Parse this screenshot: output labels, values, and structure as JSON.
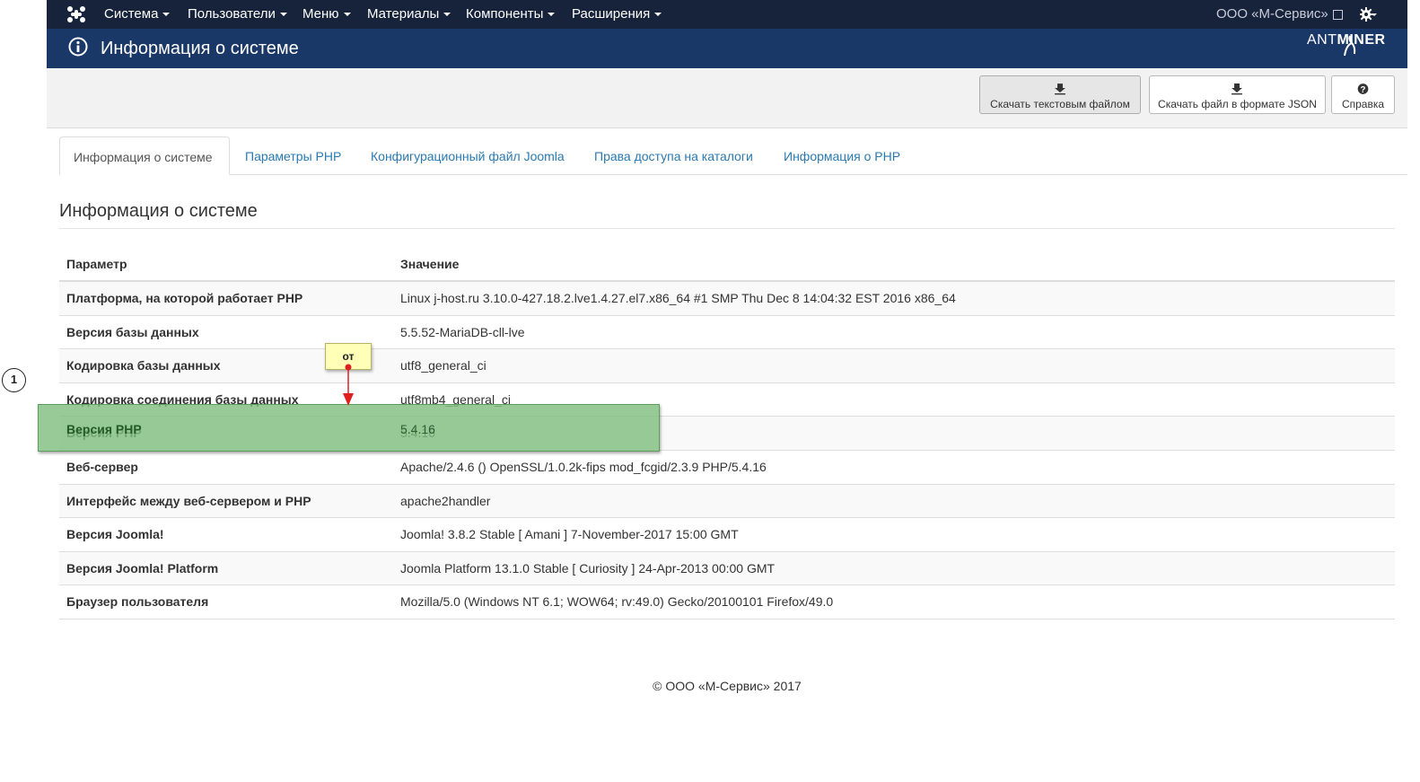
{
  "navbar": {
    "menu": [
      {
        "label": "Система"
      },
      {
        "label": "Пользователи"
      },
      {
        "label": "Меню"
      },
      {
        "label": "Материалы"
      },
      {
        "label": "Компоненты"
      },
      {
        "label": "Расширения"
      }
    ],
    "site_link": "ООО «М-Сервис»"
  },
  "header": {
    "title": "Информация о системе",
    "brand_left": "ANT",
    "brand_right": "MINER"
  },
  "toolbar": {
    "download_text": "Скачать текстовым файлом",
    "download_json": "Скачать файл в формате JSON",
    "help": "Справка"
  },
  "tabs": [
    {
      "label": "Информация о системе"
    },
    {
      "label": "Параметры PHP"
    },
    {
      "label": "Конфигурационный файл Joomla"
    },
    {
      "label": "Права доступа на каталоги"
    },
    {
      "label": "Информация о PHP"
    }
  ],
  "section_title": "Информация о системе",
  "table": {
    "headers": [
      "Параметр",
      "Значение"
    ],
    "rows": [
      {
        "param": "Платформа, на которой работает PHP",
        "value": "Linux j-host.ru 3.10.0-427.18.2.lve1.4.27.el7.x86_64 #1 SMP Thu Dec 8 14:04:32 EST 2016 x86_64"
      },
      {
        "param": "Версия базы данных",
        "value": "5.5.52-MariaDB-cll-lve"
      },
      {
        "param": "Кодировка базы данных",
        "value": "utf8_general_ci"
      },
      {
        "param": "Кодировка соединения базы данных",
        "value": "utf8mb4_general_ci"
      },
      {
        "param": "Версия PHP",
        "value": "5.4.16"
      },
      {
        "param": "Веб-сервер",
        "value": "Apache/2.4.6 () OpenSSL/1.0.2k-fips mod_fcgid/2.3.9 PHP/5.4.16"
      },
      {
        "param": "Интерфейс между веб-сервером и PHP",
        "value": "apache2handler"
      },
      {
        "param": "Версия Joomla!",
        "value": "Joomla! 3.8.2 Stable [ Amani ] 7-November-2017 15:00 GMT"
      },
      {
        "param": "Версия Joomla! Platform",
        "value": "Joomla Platform 13.1.0 Stable [ Curiosity ] 24-Apr-2013 00:00 GMT"
      },
      {
        "param": "Браузер пользователя",
        "value": "Mozilla/5.0 (Windows NT 6.1; WOW64; rv:49.0) Gecko/20100101 Firefox/49.0"
      }
    ]
  },
  "footer": "© ООО «М-Сервис» 2017",
  "annotation": {
    "step_number": "1",
    "callout_text": "от"
  },
  "colors": {
    "navbar": "#17233b",
    "header": "#1a3867",
    "link": "#2a7ab0",
    "highlight": "#80be80",
    "callout": "#ffffb8",
    "arrow": "#e02020"
  },
  "icons": [
    "joomla-logo-icon",
    "chevron-down-icon",
    "external-link-icon",
    "gear-icon",
    "info-circle-icon",
    "download-icon",
    "question-circle-icon"
  ]
}
